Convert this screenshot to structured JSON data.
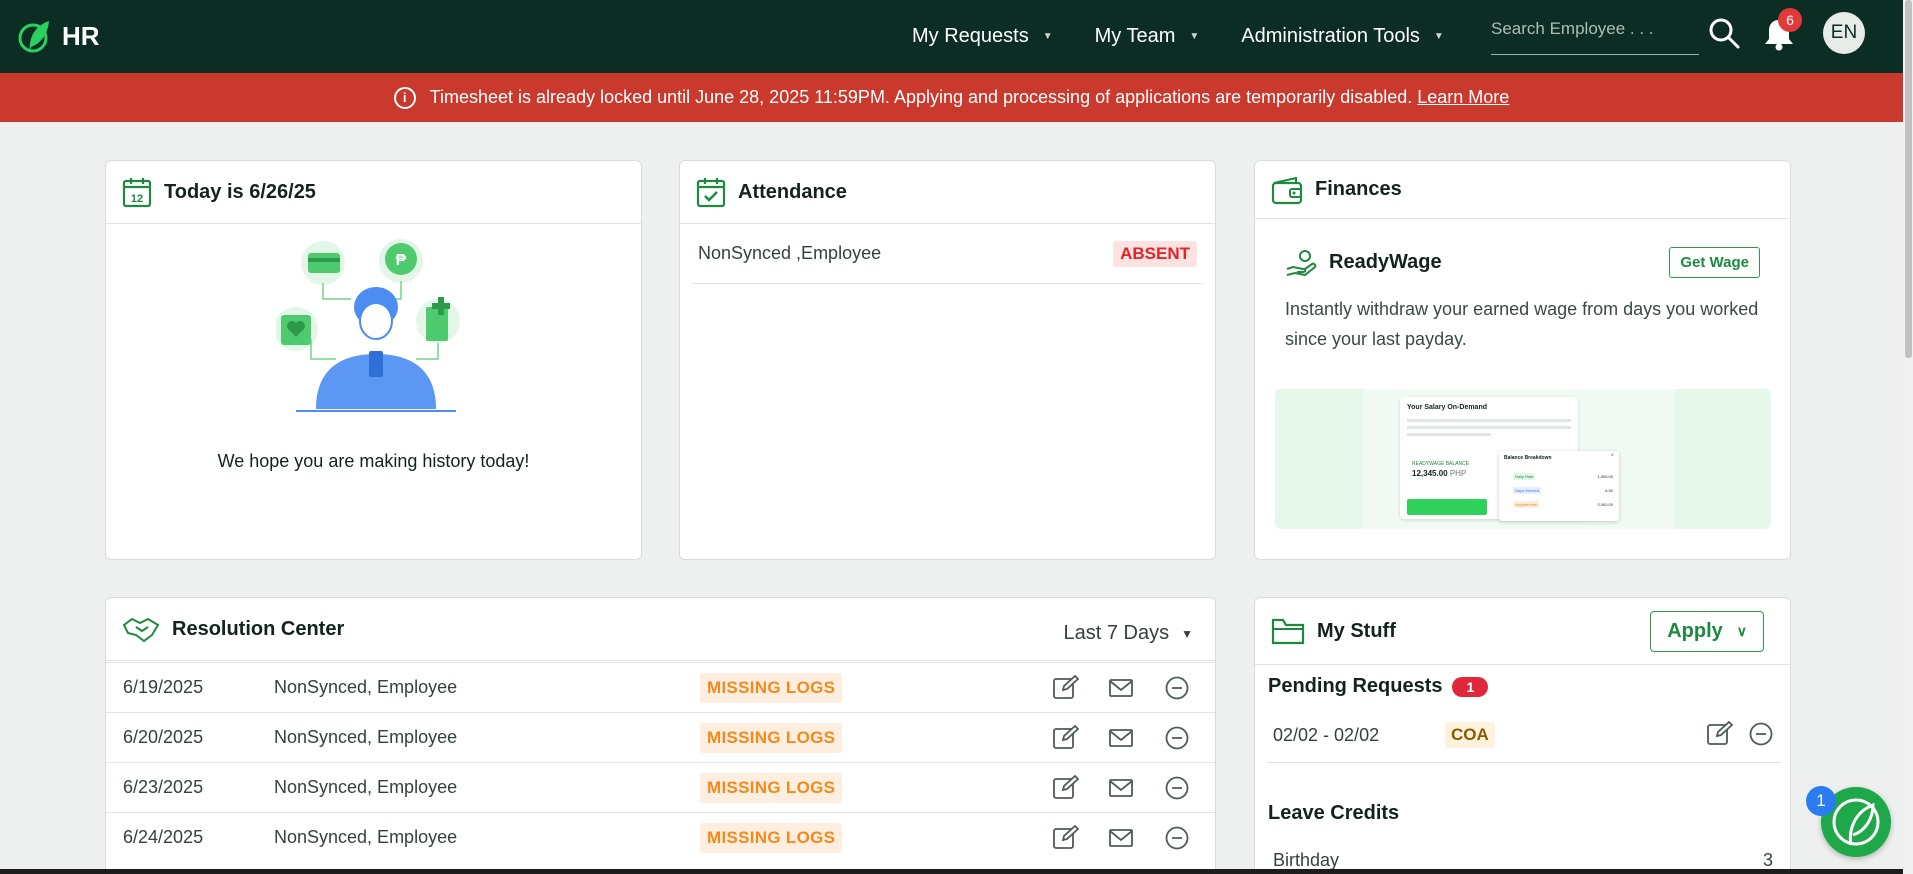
{
  "app": {
    "title": "HR"
  },
  "nav": {
    "items": [
      {
        "label": "My Requests"
      },
      {
        "label": "My Team"
      },
      {
        "label": "Administration Tools"
      }
    ],
    "search_placeholder": "Search Employee . . .",
    "notifications_count": "6",
    "language": "EN"
  },
  "alert": {
    "message": "Timesheet is already locked until June 28, 2025 11:59PM. Applying and processing of applications are temporarily disabled.",
    "link": "Learn More",
    "color": "#c9392d"
  },
  "today": {
    "title": "Today is 6/26/25",
    "message": "We hope you are making history today!",
    "calendar_day": "12"
  },
  "attendance": {
    "title": "Attendance",
    "rows": [
      {
        "name": "NonSynced ,Employee",
        "status": "ABSENT"
      }
    ]
  },
  "finances": {
    "title": "Finances",
    "readywage": {
      "title": "ReadyWage",
      "button": "Get Wage",
      "description": "Instantly withdraw your earned wage from days you worked since your last payday."
    },
    "promo": {
      "heading": "Your Salary On-Demand",
      "balance_label": "READYWAGE BALANCE",
      "balance_value": "12,345.00",
      "balance_currency": "PHP",
      "breakdown_title": "Balance Breakdown",
      "breakdown": [
        {
          "label": "Daily Rate",
          "value": "1,000.00"
        },
        {
          "label": "Days Worked",
          "value": "6.50"
        },
        {
          "label": "Adjustments",
          "value": "3,000.00"
        }
      ]
    }
  },
  "resolution": {
    "title": "Resolution Center",
    "filter": "Last 7 Days",
    "rows": [
      {
        "date": "6/19/2025",
        "name": "NonSynced, Employee",
        "status": "MISSING LOGS"
      },
      {
        "date": "6/20/2025",
        "name": "NonSynced, Employee",
        "status": "MISSING LOGS"
      },
      {
        "date": "6/23/2025",
        "name": "NonSynced, Employee",
        "status": "MISSING LOGS"
      },
      {
        "date": "6/24/2025",
        "name": "NonSynced, Employee",
        "status": "MISSING LOGS"
      }
    ]
  },
  "mystuff": {
    "title": "My Stuff",
    "apply_button": "Apply",
    "pending": {
      "title": "Pending Requests",
      "count": "1",
      "rows": [
        {
          "range": "02/02 - 02/02",
          "type": "COA"
        }
      ]
    },
    "leave": {
      "title": "Leave Credits",
      "rows": [
        {
          "label": "Birthday",
          "value": "3"
        }
      ]
    }
  },
  "chat": {
    "badge": "1"
  },
  "colors": {
    "topbar": "#0b2d23",
    "accent": "#1d8a3f",
    "danger": "#e0242a",
    "warning": "#f28a1c"
  }
}
